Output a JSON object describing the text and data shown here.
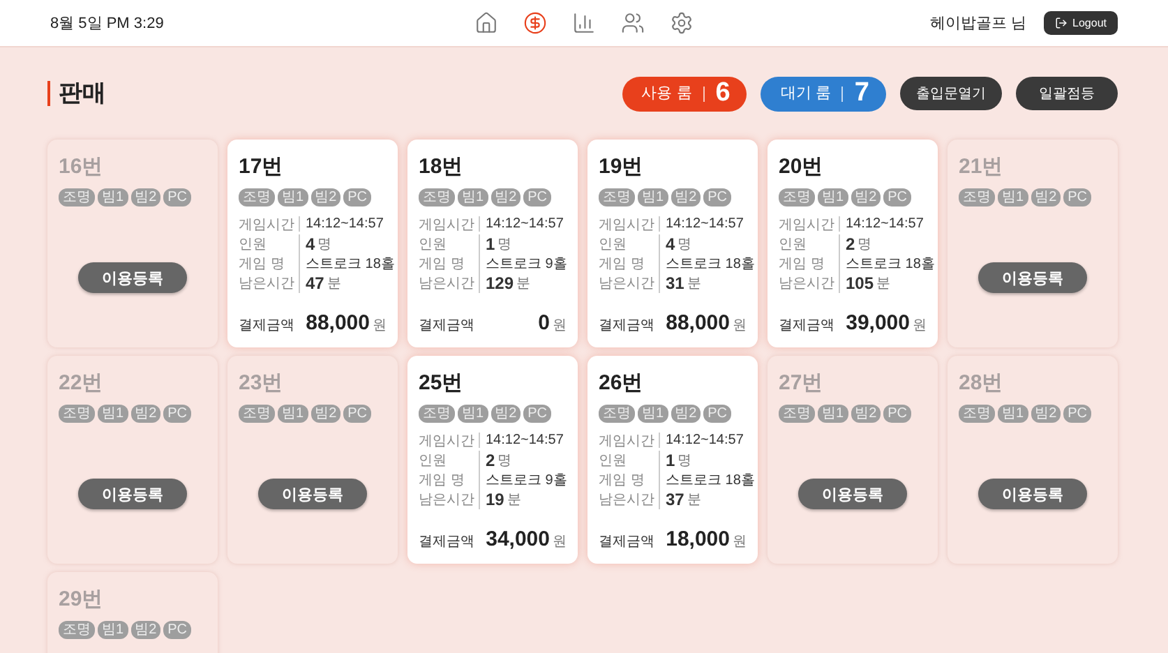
{
  "header": {
    "datetime": "8월 5일 PM 3:29",
    "nav": [
      {
        "selected": false
      },
      {
        "selected": true
      },
      {
        "selected": false
      },
      {
        "selected": false
      },
      {
        "selected": false
      }
    ],
    "user": "헤이밥골프 님",
    "logout": "Logout"
  },
  "page": {
    "title": "판매",
    "counters": [
      {
        "label": "사용 룸",
        "count": "6",
        "color": "#e8401c"
      },
      {
        "label": "대기 룸",
        "count": "7",
        "color": "#2f7fd0"
      }
    ],
    "buttons": [
      "출입문열기",
      "일괄점등"
    ]
  },
  "rooms": [
    {
      "kind": "idle",
      "name": "16번",
      "chips": [
        "조명",
        "빔1",
        "빔2",
        "PC"
      ],
      "button": "이용등록"
    },
    {
      "kind": "in_use",
      "name": "17번",
      "chips": [
        "조명",
        "빔1",
        "빔2",
        "PC"
      ],
      "fields": [
        {
          "kind": "text",
          "label": "게임시간",
          "value": "14:12~14:57"
        },
        {
          "kind": "number",
          "label": "인원",
          "value": "4",
          "unit": "명"
        },
        {
          "kind": "text",
          "label": "게임 명",
          "value": "스트로크 18홀"
        },
        {
          "kind": "number",
          "label": "남은시간",
          "value": "47",
          "unit": "분"
        }
      ],
      "pay_label": "결제금액",
      "amount": "88,000",
      "currency": "원"
    },
    {
      "kind": "in_use",
      "name": "18번",
      "chips": [
        "조명",
        "빔1",
        "빔2",
        "PC"
      ],
      "fields": [
        {
          "kind": "text",
          "label": "게임시간",
          "value": "14:12~14:57"
        },
        {
          "kind": "number",
          "label": "인원",
          "value": "1",
          "unit": "명"
        },
        {
          "kind": "text",
          "label": "게임 명",
          "value": "스트로크 9홀"
        },
        {
          "kind": "number",
          "label": "남은시간",
          "value": "129",
          "unit": "분"
        }
      ],
      "pay_label": "결제금액",
      "amount": "0",
      "currency": "원"
    },
    {
      "kind": "in_use",
      "name": "19번",
      "chips": [
        "조명",
        "빔1",
        "빔2",
        "PC"
      ],
      "fields": [
        {
          "kind": "text",
          "label": "게임시간",
          "value": "14:12~14:57"
        },
        {
          "kind": "number",
          "label": "인원",
          "value": "4",
          "unit": "명"
        },
        {
          "kind": "text",
          "label": "게임 명",
          "value": "스트로크 18홀"
        },
        {
          "kind": "number",
          "label": "남은시간",
          "value": "31",
          "unit": "분"
        }
      ],
      "pay_label": "결제금액",
      "amount": "88,000",
      "currency": "원"
    },
    {
      "kind": "in_use",
      "name": "20번",
      "chips": [
        "조명",
        "빔1",
        "빔2",
        "PC"
      ],
      "fields": [
        {
          "kind": "text",
          "label": "게임시간",
          "value": "14:12~14:57"
        },
        {
          "kind": "number",
          "label": "인원",
          "value": "2",
          "unit": "명"
        },
        {
          "kind": "text",
          "label": "게임 명",
          "value": "스트로크 18홀"
        },
        {
          "kind": "number",
          "label": "남은시간",
          "value": "105",
          "unit": "분"
        }
      ],
      "pay_label": "결제금액",
      "amount": "39,000",
      "currency": "원"
    },
    {
      "kind": "idle",
      "name": "21번",
      "chips": [
        "조명",
        "빔1",
        "빔2",
        "PC"
      ],
      "button": "이용등록"
    },
    {
      "kind": "idle",
      "name": "22번",
      "chips": [
        "조명",
        "빔1",
        "빔2",
        "PC"
      ],
      "button": "이용등록"
    },
    {
      "kind": "idle",
      "name": "23번",
      "chips": [
        "조명",
        "빔1",
        "빔2",
        "PC"
      ],
      "button": "이용등록"
    },
    {
      "kind": "in_use",
      "name": "25번",
      "chips": [
        "조명",
        "빔1",
        "빔2",
        "PC"
      ],
      "fields": [
        {
          "kind": "text",
          "label": "게임시간",
          "value": "14:12~14:57"
        },
        {
          "kind": "number",
          "label": "인원",
          "value": "2",
          "unit": "명"
        },
        {
          "kind": "text",
          "label": "게임 명",
          "value": "스트로크 9홀"
        },
        {
          "kind": "number",
          "label": "남은시간",
          "value": "19",
          "unit": "분"
        }
      ],
      "pay_label": "결제금액",
      "amount": "34,000",
      "currency": "원"
    },
    {
      "kind": "in_use",
      "name": "26번",
      "chips": [
        "조명",
        "빔1",
        "빔2",
        "PC"
      ],
      "fields": [
        {
          "kind": "text",
          "label": "게임시간",
          "value": "14:12~14:57"
        },
        {
          "kind": "number",
          "label": "인원",
          "value": "1",
          "unit": "명"
        },
        {
          "kind": "text",
          "label": "게임 명",
          "value": "스트로크 18홀"
        },
        {
          "kind": "number",
          "label": "남은시간",
          "value": "37",
          "unit": "분"
        }
      ],
      "pay_label": "결제금액",
      "amount": "18,000",
      "currency": "원"
    },
    {
      "kind": "idle",
      "name": "27번",
      "chips": [
        "조명",
        "빔1",
        "빔2",
        "PC"
      ],
      "button": "이용등록"
    },
    {
      "kind": "idle",
      "name": "28번",
      "chips": [
        "조명",
        "빔1",
        "빔2",
        "PC"
      ],
      "button": "이용등록"
    },
    {
      "kind": "idle",
      "name": "29번",
      "chips": [
        "조명",
        "빔1",
        "빔2",
        "PC"
      ]
    }
  ]
}
